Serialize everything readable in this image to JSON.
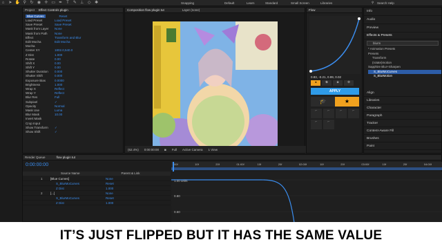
{
  "toolbar": {
    "workspaces": [
      "Default",
      "Learn",
      "Standard",
      "Small Screen",
      "Libraries"
    ],
    "snapping": "Snapping",
    "search": "Search Help"
  },
  "left": {
    "tab_project": "Project",
    "tab_effect": "Effect Controls plugin",
    "layer_label": "Blue Curves",
    "reset": "Reset",
    "rows": [
      {
        "k": "Load Preset",
        "v": "Load Preset"
      },
      {
        "k": "Save Preset",
        "v": "Save Preset"
      },
      {
        "k": "Mask from Layer",
        "v": "None"
      },
      {
        "k": "Mask from Path",
        "v": "None"
      },
      {
        "k": "Effect",
        "v": "Transform and Blur"
      },
      {
        "k": "Edit Mocha",
        "v": "Edit Mocha"
      },
      {
        "k": "Mocha",
        "v": ""
      },
      {
        "k": "Center XY",
        "v": "1802.0,540.0"
      },
      {
        "k": "Z Dist",
        "v": "1.000"
      },
      {
        "k": "Rotate",
        "v": "0.00"
      },
      {
        "k": "Shift X",
        "v": "0.00"
      },
      {
        "k": "Shift Y",
        "v": "0.00"
      },
      {
        "k": "Shutter Duration",
        "v": "0.000"
      },
      {
        "k": "Shutter Shift",
        "v": "0.000"
      },
      {
        "k": "Exposure Bias",
        "v": "0.0000"
      },
      {
        "k": "Brightness",
        "v": "1.000"
      },
      {
        "k": "Wrap X",
        "v": "Reflect"
      },
      {
        "k": "Wrap Y",
        "v": "Reflect"
      },
      {
        "k": "Blur Res",
        "v": "Full"
      },
      {
        "k": "Subpixel",
        "v": "✓"
      },
      {
        "k": "Opacity",
        "v": "Normal"
      },
      {
        "k": "Mask Use",
        "v": "Luma"
      },
      {
        "k": "Blur Mask",
        "v": "10.00"
      },
      {
        "k": "Invert Mask",
        "v": ""
      },
      {
        "k": "Crop Input",
        "v": ""
      },
      {
        "k": "Show Transform",
        "v": "✓"
      },
      {
        "k": "Show Shift",
        "v": "✓"
      }
    ]
  },
  "viewer": {
    "tab": "Composition flow plugin tut",
    "layer": "Layer (none)",
    "zoom": "(62.4%)",
    "timecode": "0:00:00:00",
    "res": "Full",
    "camera": "Active Camera",
    "views": "1 View"
  },
  "flow": {
    "title": "Flow",
    "values": "0.83, -0.21, 0.99, 0.02",
    "apply": "APPLY"
  },
  "right": {
    "items": [
      "Info",
      "Audio",
      "Preview"
    ],
    "effects_title": "Effects & Presets",
    "search": "blurm",
    "tree": [
      "* Animation Presets",
      "Presets",
      "Transform",
      "(rotate)motion",
      "Sapphire Blur+Sharpen",
      "S_BlurMoCurves",
      "S_BlurMotion"
    ],
    "items2": [
      "Align",
      "Libraries",
      "Character",
      "Paragraph",
      "Tracker",
      "Content-Aware Fill",
      "Brushes",
      "Paint"
    ]
  },
  "timeline": {
    "tab_render": "Render Queue",
    "tab_comp": "flow plugin tut",
    "timecode": "0:00:00:00",
    "cols": [
      "Source Name",
      "Parent & Link"
    ],
    "layers": [
      {
        "num": "1",
        "name": "[Blue Curves]",
        "parent": "None"
      },
      {
        "num": "",
        "name": "S_BlurMoCurves",
        "parent": "Reset"
      },
      {
        "num": "",
        "name": "Z Dist",
        "parent": "1.000"
      },
      {
        "num": "2",
        "name": "[...]",
        "parent": "None"
      },
      {
        "num": "",
        "name": "S_BlurMoCurves",
        "parent": "Reset"
      },
      {
        "num": "",
        "name": "Z Dist",
        "parent": "1.000"
      }
    ],
    "ruler": [
      "00f",
      "10f",
      "20f",
      "01:00f",
      "10f",
      "20f",
      "02:00f",
      "10f",
      "20f",
      "03:00f",
      "10f",
      "20f",
      "04:00f"
    ],
    "graph_labels": [
      "1.00 units",
      "0.80",
      "0.60"
    ]
  },
  "caption": "IT’S JUST FLIPPED BUT IT HAS THE SAME VALUE",
  "colors": {
    "accent": "#2d8cf0",
    "apply": "#2f9be8",
    "star": "#f0a11e"
  }
}
